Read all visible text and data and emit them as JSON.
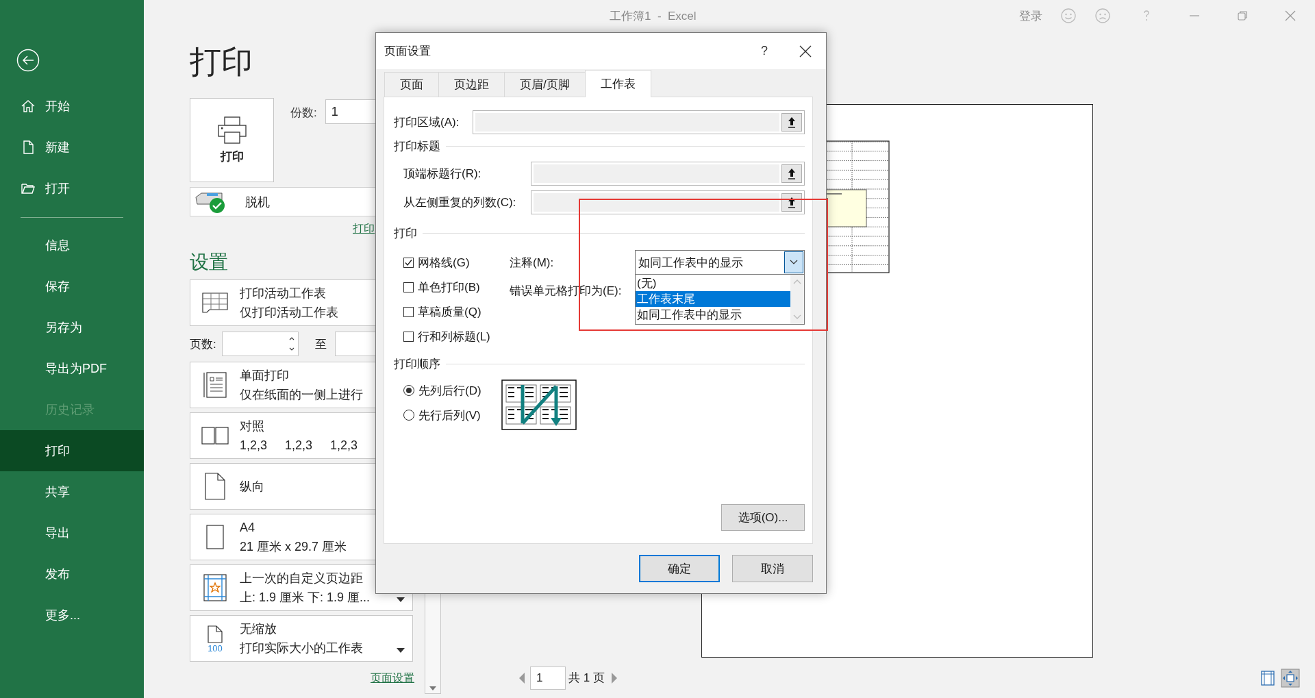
{
  "window": {
    "title": "工作簿1  -  Excel",
    "account": "登录"
  },
  "backstage": {
    "nav": [
      {
        "label": "开始",
        "kind": "primary",
        "selected": false,
        "disabled": false
      },
      {
        "label": "新建",
        "kind": "primary",
        "selected": false,
        "disabled": false
      },
      {
        "label": "打开",
        "kind": "primary",
        "selected": false,
        "disabled": false
      },
      {
        "label": "信息",
        "kind": "secondary",
        "selected": false,
        "disabled": false
      },
      {
        "label": "保存",
        "kind": "secondary",
        "selected": false,
        "disabled": false
      },
      {
        "label": "另存为",
        "kind": "secondary",
        "selected": false,
        "disabled": false
      },
      {
        "label": "导出为PDF",
        "kind": "secondary",
        "selected": false,
        "disabled": false
      },
      {
        "label": "历史记录",
        "kind": "secondary",
        "selected": false,
        "disabled": true
      },
      {
        "label": "打印",
        "kind": "secondary",
        "selected": true,
        "disabled": false
      },
      {
        "label": "共享",
        "kind": "secondary",
        "selected": false,
        "disabled": false
      },
      {
        "label": "导出",
        "kind": "secondary",
        "selected": false,
        "disabled": false
      },
      {
        "label": "发布",
        "kind": "secondary",
        "selected": false,
        "disabled": false
      },
      {
        "label": "更多...",
        "kind": "secondary",
        "selected": false,
        "disabled": false
      }
    ]
  },
  "print": {
    "title": "打印",
    "print_button": "打印",
    "copies_label": "份数:",
    "copies_value": "1",
    "printer": "脱机",
    "printer_link": "打印",
    "settings_title": "设置",
    "options": [
      {
        "kind": "sheet",
        "title": "打印活动工作表",
        "subtitle": "仅打印活动工作表"
      },
      {
        "kind": "pages",
        "label": "页数:",
        "to_label": "至"
      },
      {
        "kind": "sides",
        "title": "单面打印",
        "subtitle": "仅在纸面的一侧上进行"
      },
      {
        "kind": "collate",
        "title": "对照",
        "subtitle": [
          "1,2,3",
          "1,2,3",
          "1,2,3"
        ]
      },
      {
        "kind": "orientation",
        "title": "纵向"
      },
      {
        "kind": "paper",
        "title": "A4",
        "subtitle": "21 厘米 x 29.7 厘米"
      },
      {
        "kind": "margins",
        "title": "上一次的自定义页边距",
        "subtitle": "上: 1.9 厘米 下: 1.9 厘...",
        "dropdown": true
      },
      {
        "kind": "scaling",
        "title": "无缩放",
        "subtitle": "打印实际大小的工作表",
        "icon_text": "100",
        "dropdown": true
      }
    ],
    "page_setup_link": "页面设置"
  },
  "preview": {
    "page_number": "1",
    "page_total": "共 1 页"
  },
  "page_setup": {
    "title": "页面设置",
    "help": "?",
    "tabs": [
      {
        "label": "页面",
        "selected": false
      },
      {
        "label": "页边距",
        "selected": false
      },
      {
        "label": "页眉/页脚",
        "selected": false
      },
      {
        "label": "工作表",
        "selected": true
      }
    ],
    "print_area_label": "打印区域(A):",
    "titles_group": "打印标题",
    "title_rows_label": "顶端标题行(R):",
    "title_cols_label": "从左侧重复的列数(C):",
    "print_group": "打印",
    "checkboxes": [
      {
        "label": "网格线(G)",
        "checked": true
      },
      {
        "label": "单色打印(B)",
        "checked": false
      },
      {
        "label": "草稿质量(Q)",
        "checked": false
      },
      {
        "label": "行和列标题(L)",
        "checked": false
      }
    ],
    "comments_label": "注释(M):",
    "comments_value": "如同工作表中的显示",
    "errors_label": "错误单元格打印为(E):",
    "dropdown_list": [
      {
        "label": "(无)",
        "selected": false
      },
      {
        "label": "工作表末尾",
        "selected": true
      },
      {
        "label": "如同工作表中的显示",
        "selected": false
      }
    ],
    "order_group": "打印顺序",
    "order_radios": [
      {
        "label": "先列后行(D)",
        "selected": true
      },
      {
        "label": "先行后列(V)",
        "selected": false
      }
    ],
    "options_button": "选项(O)...",
    "ok": "确定",
    "cancel": "取消"
  },
  "annotations": [
    {
      "kind": "frame"
    }
  ]
}
